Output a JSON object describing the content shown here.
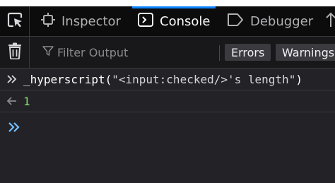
{
  "tabs": [
    {
      "label": "Inspector",
      "icon": "inspector-icon",
      "selected": false
    },
    {
      "label": "Console",
      "icon": "console-icon",
      "selected": true
    },
    {
      "label": "Debugger",
      "icon": "debugger-icon",
      "selected": false
    }
  ],
  "toolbar": {
    "filter_placeholder": "Filter Output",
    "errors_label": "Errors",
    "warnings_label": "Warnings"
  },
  "console": {
    "input_fn": "_hyperscript",
    "input_open": "(",
    "input_string": "\"<input:checked/>'s length\"",
    "input_close": ")",
    "result": "1"
  },
  "colors": {
    "accent": "#0a84ff",
    "result_number": "#86de74",
    "prompt_icon": "#75bfff"
  }
}
